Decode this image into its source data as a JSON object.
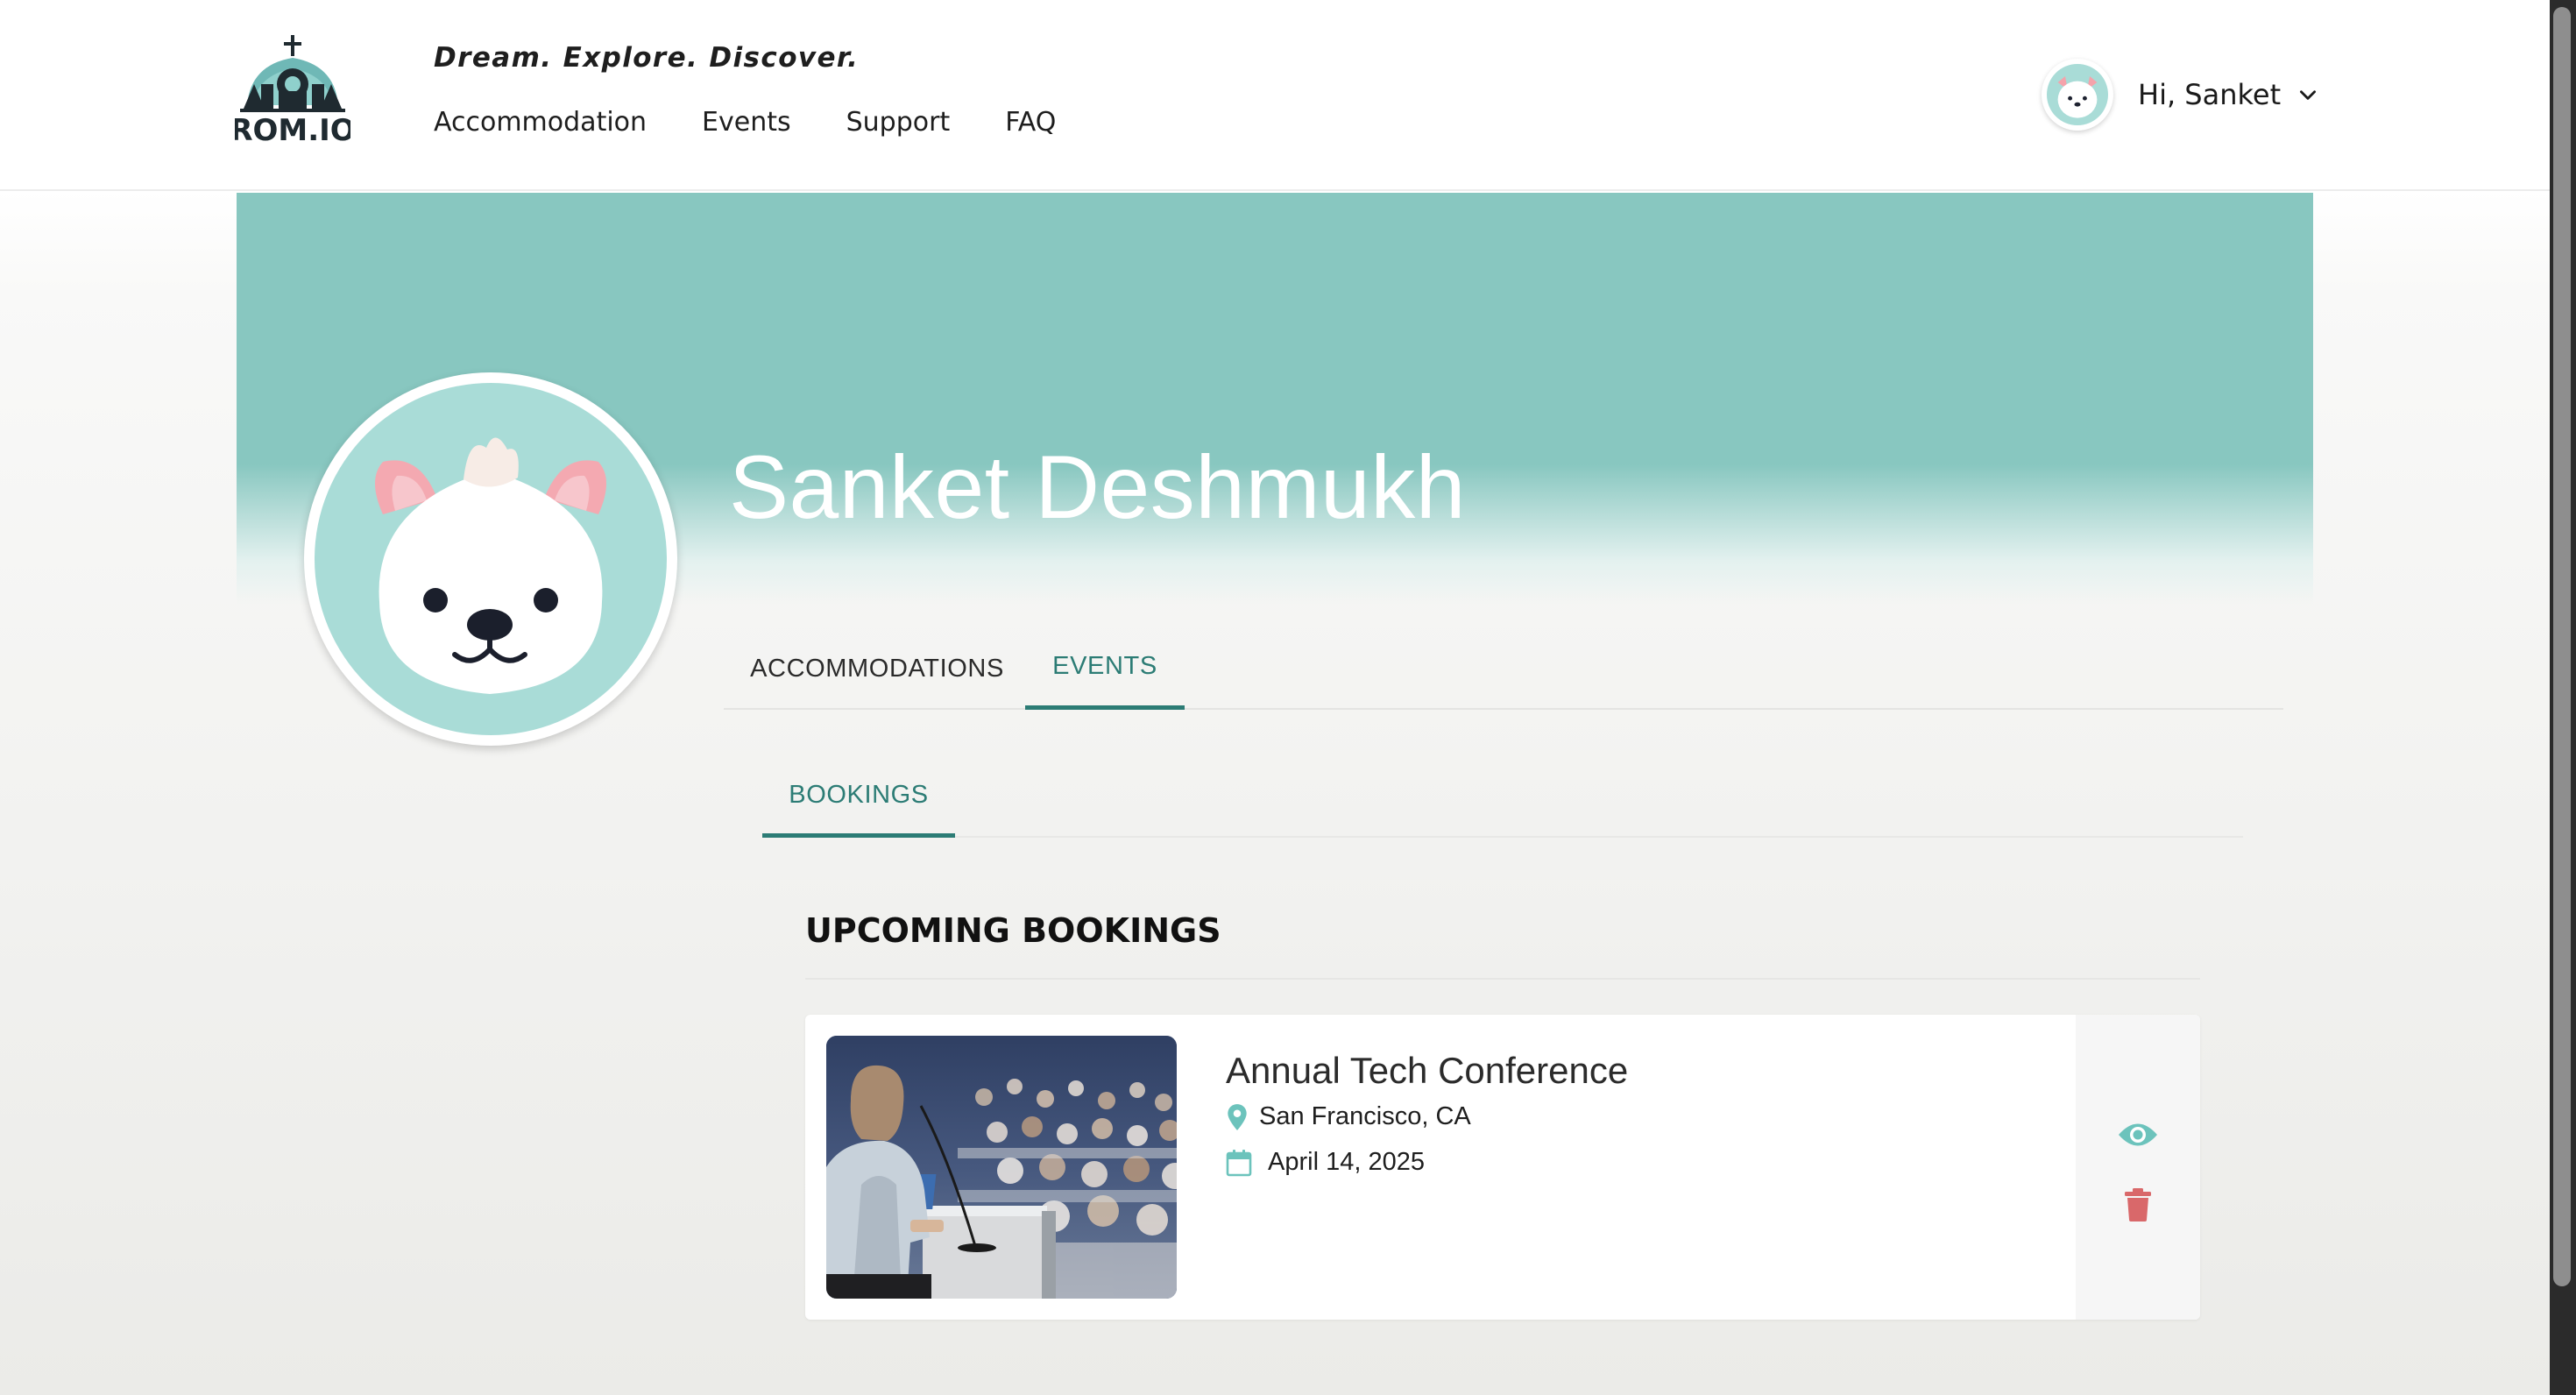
{
  "header": {
    "logo_text": "ROM.IO",
    "tagline": "Dream. Explore. Discover.",
    "nav": [
      {
        "label": "Accommodation"
      },
      {
        "label": "Events"
      },
      {
        "label": "Support"
      },
      {
        "label": "FAQ"
      }
    ],
    "user_greeting": "Hi, Sanket"
  },
  "profile": {
    "name": "Sanket Deshmukh"
  },
  "tabs": [
    {
      "label": "ACCOMMODATIONS",
      "active": false
    },
    {
      "label": "EVENTS",
      "active": true
    }
  ],
  "subtabs": [
    {
      "label": "BOOKINGS",
      "active": true
    }
  ],
  "bookings": {
    "title": "UPCOMING BOOKINGS",
    "items": [
      {
        "title": "Annual Tech Conference",
        "location": "San Francisco, CA",
        "date": "April 14, 2025"
      }
    ]
  },
  "icons": {
    "location": "map-pin-icon",
    "date": "calendar-icon",
    "view": "eye-icon",
    "delete": "trash-icon",
    "dropdown": "chevron-down-icon"
  },
  "colors": {
    "accent": "#2c7c75",
    "hero_teal": "#88c7c0",
    "icon_teal": "#6cc3bc",
    "delete_red": "#d9686a",
    "avatar_bg": "#a9dcd7"
  }
}
